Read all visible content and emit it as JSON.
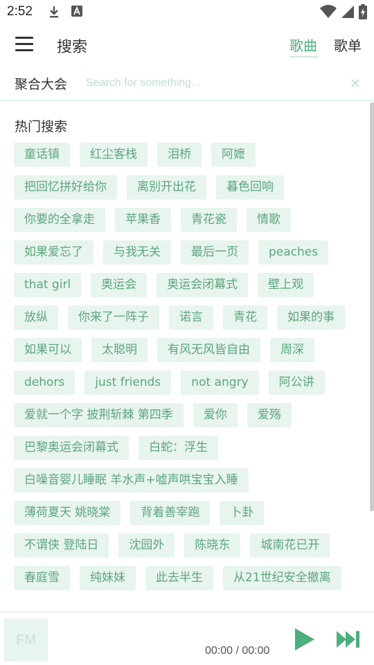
{
  "status_bar": {
    "time": "2:52",
    "icons": [
      "download-icon",
      "a-app-icon",
      "wifi-icon",
      "signal-icon",
      "battery-icon"
    ]
  },
  "app_bar": {
    "title": "搜索",
    "tabs": [
      {
        "label": "歌曲",
        "active": true
      },
      {
        "label": "歌单",
        "active": false
      }
    ]
  },
  "search": {
    "source": "聚合大会",
    "placeholder": "Search for something..."
  },
  "hot_search": {
    "title": "热门搜索",
    "tags": [
      "童话镇",
      "红尘客栈",
      "泪桥",
      "阿嬷",
      "把回忆拼好给你",
      "离别开出花",
      "暮色回响",
      "你要的全拿走",
      "苹果香",
      "青花瓷",
      "情歌",
      "如果爱忘了",
      "与我无关",
      "最后一页",
      "peaches",
      "that girl",
      "奥运会",
      "奥运会闭幕式",
      "壁上观",
      "放纵",
      "你来了一阵子",
      "诺言",
      "青花",
      "如果的事",
      "如果可以",
      "太聪明",
      "有风无风皆自由",
      "周深",
      "dehors",
      "just friends",
      "not angry",
      "阿公讲",
      "爱就一个字 披荆斩棘 第四季",
      "爱你",
      "爱殇",
      "巴黎奥运会闭幕式",
      "白蛇：浮生",
      "白噪音婴儿睡眠 羊水声+嘘声哄宝宝入睡",
      "薄荷夏天 姚晓棠",
      "背着善宰跑",
      "卜卦",
      "不谓侠 登陆日",
      "沈园外",
      "陈晓东",
      "城南花已开",
      "春庭雪",
      "纯妹妹",
      "此去半生",
      "从21世纪安全撤离"
    ]
  },
  "player": {
    "cover_text": "FM",
    "time": "00:00 / 00:00"
  },
  "colors": {
    "accent": "#4caf7d",
    "tag_bg": "#e8f4ee",
    "tag_text": "#5ca67e"
  }
}
